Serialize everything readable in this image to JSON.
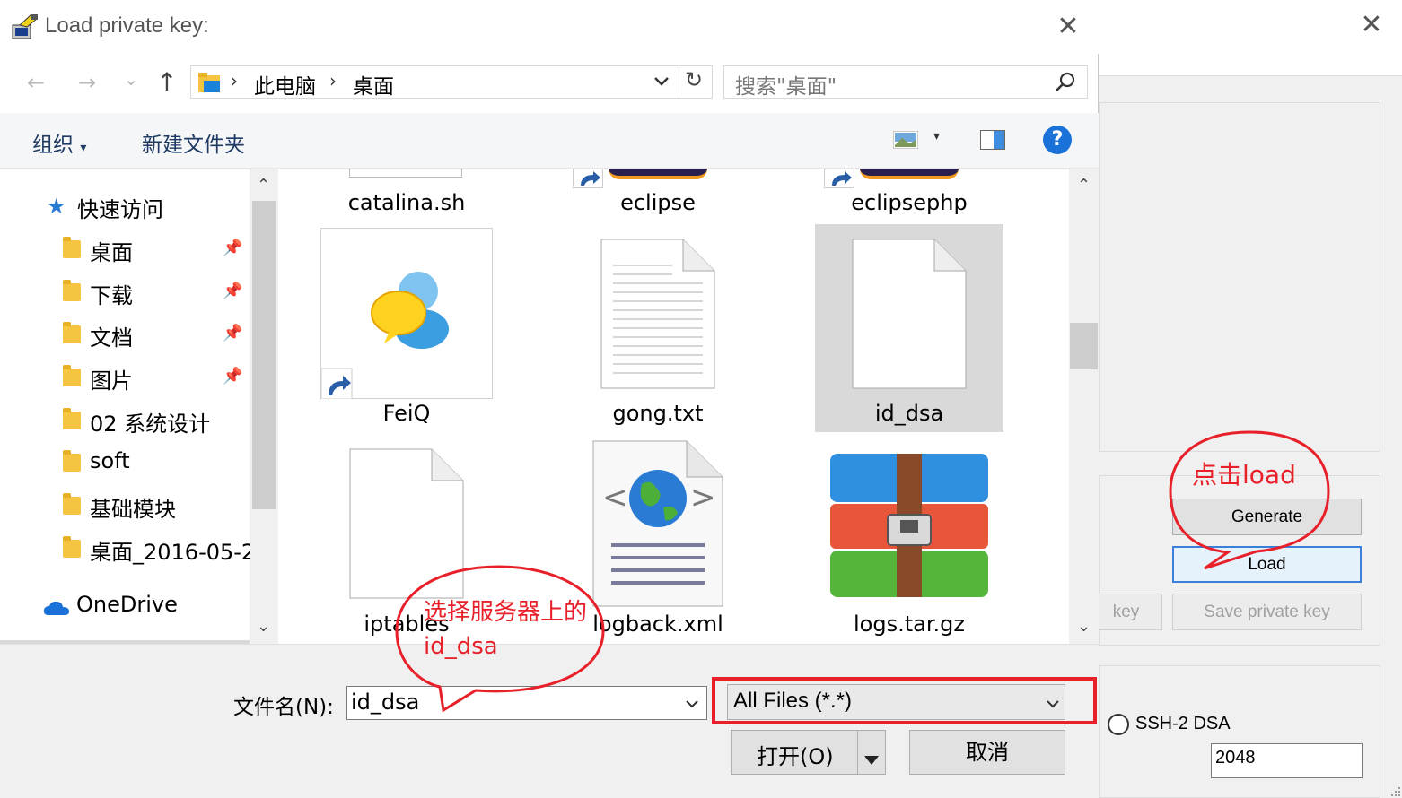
{
  "dialog": {
    "title": "Load private key:",
    "close_glyph": "✕"
  },
  "nav": {
    "back_glyph": "←",
    "forward_glyph": "→",
    "recent_glyph": "⌄",
    "up_glyph": "↑",
    "breadcrumb": [
      "此电脑",
      "桌面"
    ],
    "refresh_glyph": "↻",
    "search_placeholder": "搜索\"桌面\""
  },
  "toolbar": {
    "organize_label": "组织",
    "new_folder_label": "新建文件夹",
    "help_glyph": "?"
  },
  "sidebar": {
    "quick_access": "快速访问",
    "items": [
      {
        "label": "桌面",
        "pinned": true
      },
      {
        "label": "下载",
        "pinned": true
      },
      {
        "label": "文档",
        "pinned": true
      },
      {
        "label": "图片",
        "pinned": true
      },
      {
        "label": "02 系统设计",
        "pinned": false
      },
      {
        "label": "soft",
        "pinned": false
      },
      {
        "label": "基础模块",
        "pinned": false
      },
      {
        "label": "桌面_2016-05-2",
        "pinned": false
      }
    ],
    "onedrive": "OneDrive"
  },
  "files": [
    {
      "name": "catalina.sh",
      "icon": "document-icon"
    },
    {
      "name": "eclipse",
      "icon": "eclipse-shortcut-icon"
    },
    {
      "name": "eclipsephp",
      "icon": "eclipse-shortcut-icon"
    },
    {
      "name": "FeiQ",
      "icon": "feiq-chat-icon"
    },
    {
      "name": "gong.txt",
      "icon": "text-file-icon"
    },
    {
      "name": "id_dsa",
      "icon": "blank-file-icon",
      "selected": true
    },
    {
      "name": "iptables",
      "icon": "blank-file-icon"
    },
    {
      "name": "logback.xml",
      "icon": "xml-globe-icon"
    },
    {
      "name": "logs.tar.gz",
      "icon": "haozip-archive-icon"
    }
  ],
  "bottom": {
    "filename_label": "文件名(N):",
    "filename_value": "id_dsa",
    "filter_value": "All Files (*.*)",
    "open_label": "打开(O)",
    "cancel_label": "取消"
  },
  "background_window": {
    "close_glyph": "✕",
    "generate_label": "Generate",
    "load_label": "Load",
    "save_public_label_partial": "key",
    "save_private_label": "Save private key",
    "radio_label": "SSH-2 DSA",
    "bits_value": "2048"
  },
  "annotations": {
    "click_load": "点击load",
    "select_line1": "选择服务器上的",
    "select_line2": "id_dsa"
  },
  "colors": {
    "annotation_red": "#e8202a",
    "selection_bg": "#d9d9d9",
    "link_blue": "#1e3a64",
    "help_blue": "#1a72d8"
  }
}
